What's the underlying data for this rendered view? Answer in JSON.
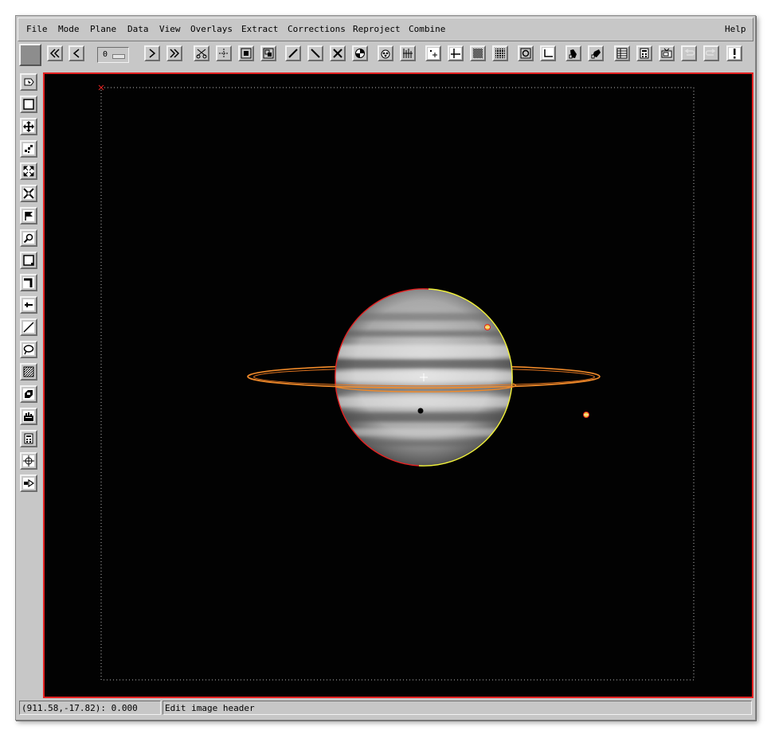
{
  "menubar": {
    "items": [
      {
        "label": "File"
      },
      {
        "label": "Mode"
      },
      {
        "label": "Plane"
      },
      {
        "label": "Data"
      },
      {
        "label": "View"
      },
      {
        "label": "Overlays"
      },
      {
        "label": "Extract"
      },
      {
        "label": "Corrections"
      },
      {
        "label": "Reproject"
      },
      {
        "label": "Combine"
      }
    ],
    "help_label": "Help"
  },
  "toolbar": {
    "plane_value": "0",
    "buttons": [
      "first-plane-icon",
      "previous-plane-icon",
      "next-plane-icon",
      "last-plane-icon",
      "cut-icon",
      "crop-icon",
      "frame-icon",
      "copy-region-icon",
      "draw-line-icon",
      "diagonal-line-icon",
      "x-tools-icon",
      "color-wheel-icon",
      "palette-icon",
      "histogram-bars-icon",
      "point-marker-icon",
      "crosshair-icon",
      "grid-dither-icon",
      "grid-dots-icon",
      "frame-circle-icon",
      "axes-icon",
      "thumb-left-icon",
      "thumb-right-icon",
      "table-icon",
      "calculator-icon",
      "tv-icon",
      "undo-icon",
      "redo-icon",
      "alert-icon"
    ]
  },
  "tools": [
    "select-cursor-icon",
    "rectangle-icon",
    "pan-move-icon",
    "pixel-grid-icon",
    "zoom-fit-icon",
    "zoom-out-fit-icon",
    "flag-icon",
    "magnifier-icon",
    "rectangle-outline-icon",
    "corner-icon",
    "slice-icon",
    "line-icon",
    "lasso-icon",
    "texture-icon",
    "paint-icon",
    "histogram-icon",
    "calculator-icon",
    "center-target-icon",
    "arrow-right-icon"
  ],
  "colors": {
    "display_border": "#e42222",
    "ring": "#f08a2a",
    "limb_red": "#e42222",
    "limb_yellow": "#f2f23a"
  },
  "status": {
    "coords": "(911.58,-17.82): 0.000",
    "message": "Edit image header"
  }
}
